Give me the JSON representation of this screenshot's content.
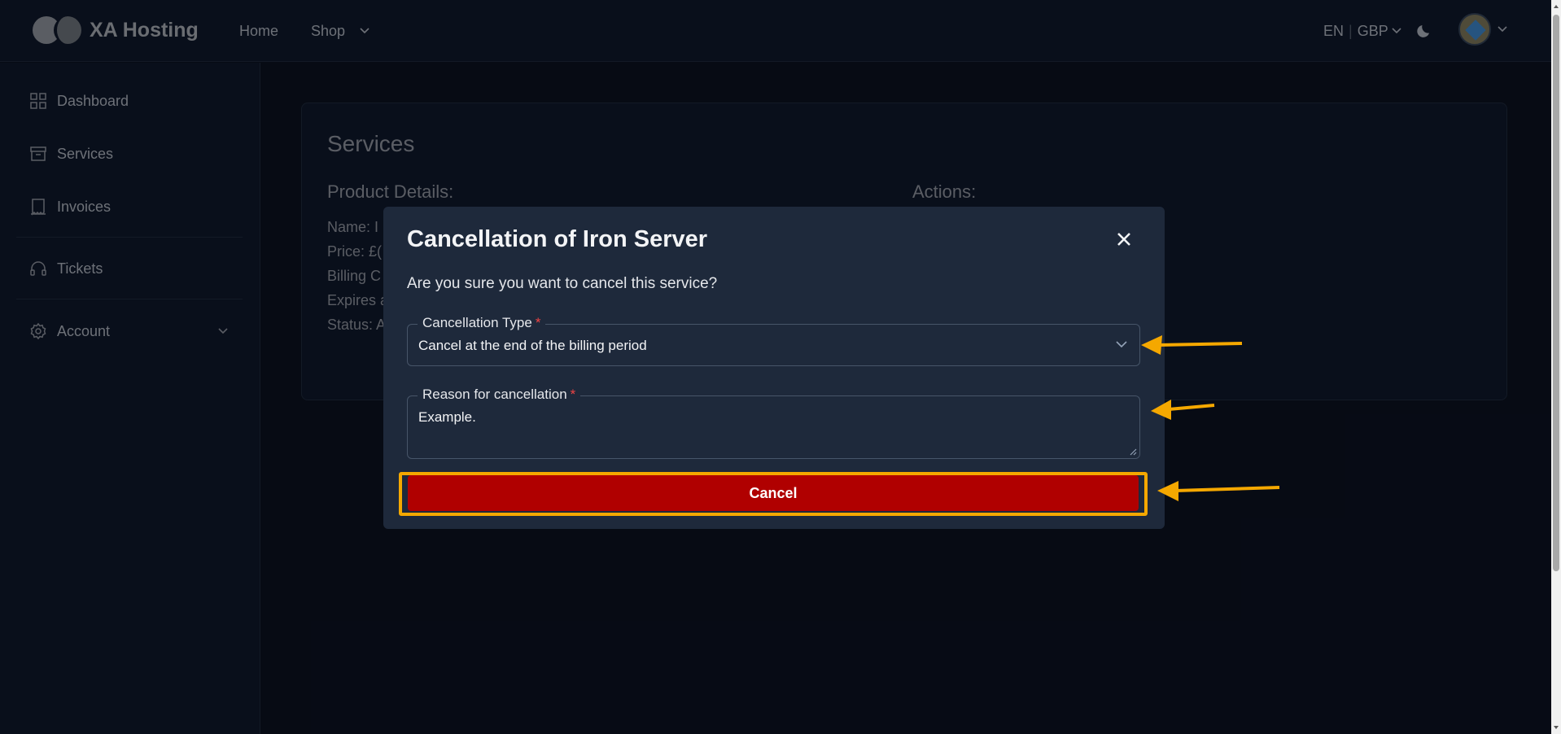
{
  "brand": {
    "name": "XA Hosting"
  },
  "nav": {
    "home": "Home",
    "shop": "Shop"
  },
  "header": {
    "language": "EN",
    "currency": "GBP"
  },
  "sidebar": {
    "items": [
      {
        "label": "Dashboard",
        "icon": "grid-icon"
      },
      {
        "label": "Services",
        "icon": "archive-icon"
      },
      {
        "label": "Invoices",
        "icon": "receipt-icon"
      },
      {
        "label": "Tickets",
        "icon": "headset-icon"
      },
      {
        "label": "Account",
        "icon": "gear-icon"
      }
    ]
  },
  "card": {
    "title": "Services",
    "product_heading": "Product Details:",
    "actions_heading": "Actions:",
    "details": [
      {
        "label": "Name:",
        "value": "I"
      },
      {
        "label": "Price:",
        "value": "£("
      },
      {
        "label": "Billing C",
        "value": ""
      },
      {
        "label": "Expires a",
        "value": ""
      },
      {
        "label": "Status:",
        "value": "A"
      }
    ]
  },
  "modal": {
    "title": "Cancellation of Iron Server",
    "question": "Are you sure you want to cancel this service?",
    "cancellation_type": {
      "label": "Cancellation Type",
      "required_mark": "*",
      "value": "Cancel at the end of the billing period"
    },
    "reason": {
      "label": "Reason for cancellation",
      "required_mark": "*",
      "value": "Example."
    },
    "submit_label": "Cancel"
  },
  "colors": {
    "accent_annotation": "#f5a800",
    "danger": "#b00000",
    "background": "#0b1120",
    "panel": "#1e293b"
  }
}
